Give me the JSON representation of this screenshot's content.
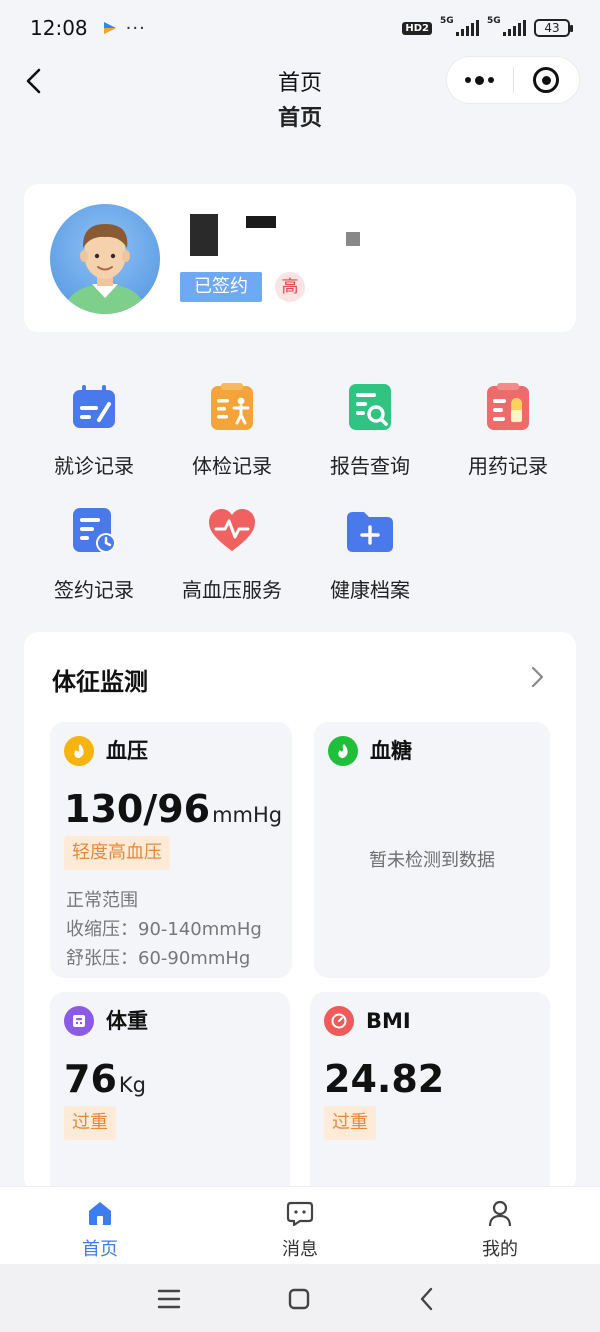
{
  "status_bar": {
    "time": "12:08",
    "more": "···",
    "hd_label": "HD2",
    "network_1": "5G",
    "network_2": "5G",
    "battery": "43"
  },
  "nav": {
    "title": "首页"
  },
  "page": {
    "peek_title": "首页"
  },
  "profile": {
    "signed_label": "已签约",
    "risk_label": "高"
  },
  "menu": {
    "items": [
      {
        "label": "就诊记录",
        "icon": "calendar-edit-icon",
        "color": "#4a79ec"
      },
      {
        "label": "体检记录",
        "icon": "checkup-icon",
        "color": "#f5a43a"
      },
      {
        "label": "报告查询",
        "icon": "report-search-icon",
        "color": "#2fc482"
      },
      {
        "label": "用药记录",
        "icon": "medicine-icon",
        "color": "#ef6a6a"
      },
      {
        "label": "签约记录",
        "icon": "sign-record-icon",
        "color": "#4a79ec"
      },
      {
        "label": "高血压服务",
        "icon": "heartbeat-icon",
        "color": "#f06262"
      },
      {
        "label": "健康档案",
        "icon": "folder-add-icon",
        "color": "#4a79ec"
      }
    ]
  },
  "vitals": {
    "title": "体征监测",
    "blood_pressure": {
      "name": "血压",
      "value": "130/96",
      "unit": "mmHg",
      "status": "轻度高血压",
      "range_title": "正常范围",
      "systolic": "收缩压：90-140mmHg",
      "diastolic": "舒张压：60-90mmHg",
      "icon_color": "#f6b40e"
    },
    "blood_sugar": {
      "name": "血糖",
      "empty": "暂未检测到数据",
      "icon_color": "#1fbf3a"
    },
    "weight": {
      "name": "体重",
      "value": "76",
      "unit": "Kg",
      "status": "过重",
      "icon_color": "#8b5be8"
    },
    "bmi": {
      "name": "BMI",
      "value": "24.82",
      "status": "过重",
      "icon_color": "#ef5a5a"
    }
  },
  "tab_bar": {
    "tabs": [
      {
        "label": "首页",
        "icon": "home-icon"
      },
      {
        "label": "消息",
        "icon": "message-icon"
      },
      {
        "label": "我的",
        "icon": "user-icon"
      }
    ],
    "active_color": "#3c7ef0"
  }
}
